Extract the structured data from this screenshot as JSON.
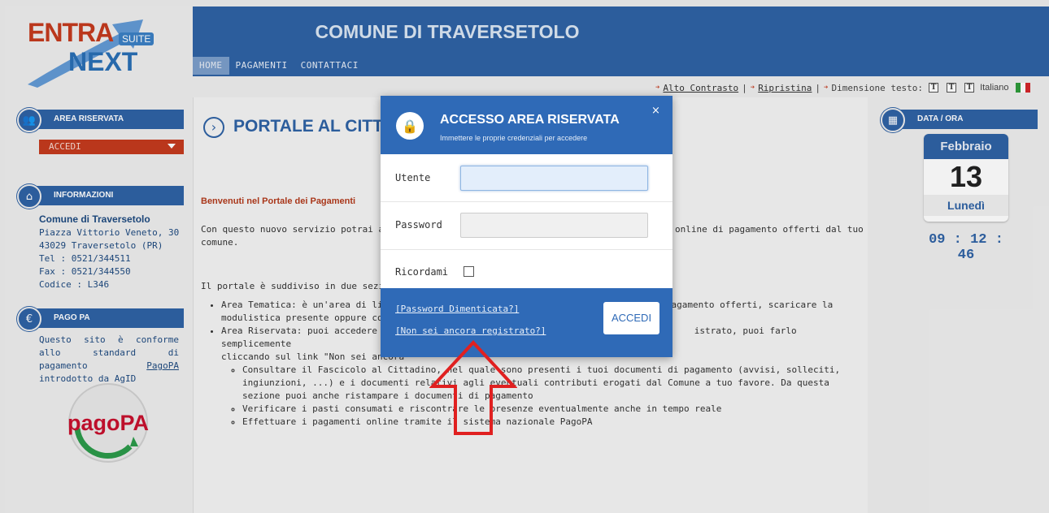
{
  "header": {
    "logo": {
      "entra": "ENTRA",
      "suite": "SUITE",
      "next": "NEXT"
    },
    "site_title": "COMUNE DI TRAVERSETOLO",
    "nav": [
      {
        "label": "HOME",
        "active": true
      },
      {
        "label": "PAGAMENTI",
        "active": false
      },
      {
        "label": "CONTATTACI",
        "active": false
      }
    ],
    "access": {
      "high_contrast": "Alto Contrasto",
      "sep1": "|",
      "restore": "Ripristina",
      "sep2": "|",
      "text_size_label": "Dimensione testo:",
      "size_glyph": "T",
      "language": "Italiano"
    }
  },
  "sidebar": {
    "area_riservata": {
      "title": "AREA RISERVATA",
      "dropdown": "ACCEDI"
    },
    "informazioni": {
      "title": "INFORMAZIONI",
      "name": "Comune di Traversetolo",
      "address": "Piazza Vittorio Veneto, 30",
      "city": "43029 Traversetolo (PR)",
      "tel": "Tel : 0521/344511",
      "fax": "Fax : 0521/344550",
      "code": "Codice : L346"
    },
    "pago_pa": {
      "title": "PAGO PA",
      "text_before": "Questo sito è conforme allo standard di pagamento ",
      "link": "PagoPA",
      "text_after": " introdotto da AgID",
      "logo_text": "pagoPA"
    }
  },
  "main": {
    "title": "PORTALE AL CITTAD",
    "welcome": "Benvenuti nel Portale dei Pagamenti",
    "intro_left": "Con questo nuovo servizio potrai accede",
    "intro_right": "online di pagamento offerti dal tuo",
    "intro_line2": "comune.",
    "sections_intro": "Il portale è suddiviso in due sezioni:",
    "bullet1_a": "Area Tematica: è un'area di libera",
    "bullet1_b": "ti di pagamento offerti, scaricare la",
    "bullet1_line2": "modulistica presente oppure cont",
    "bullet2_a": "Area Riservata: puoi accedere all'A",
    "bullet2_b": "istrato, puoi farlo semplicemente",
    "bullet2_line2": "cliccando sul link \"Non sei ancora",
    "sub1": "Consultare il Fascicolo al Cittadino, nel quale sono presenti i tuoi documenti di pagamento (avvisi, solleciti, ingiunzioni, ...) e i documenti relativi agli eventuali contributi erogati dal Comune a tuo favore. Da questa sezione puoi anche ristampare i documenti di pagamento",
    "sub2": "Verificare i pasti consumati e riscontrare le presenze eventualmente anche in tempo reale",
    "sub3": "Effettuare i pagamenti online tramite il sistema nazionale PagoPA"
  },
  "date_time": {
    "title": "DATA / ORA",
    "month": "Febbraio",
    "day": "13",
    "weekday": "Lunedì",
    "time": "09 : 12 : 46"
  },
  "login_modal": {
    "title": "ACCESSO AREA RISERVATA",
    "subtitle": "Immettere le proprie credenziali per accedere",
    "close": "×",
    "user_label": "Utente",
    "password_label": "Password",
    "remember_label": "Ricordami",
    "forgot_link": "[Password Dimenticata?]",
    "register_link": "[Non sei ancora registrato?]",
    "submit": "ACCEDI"
  },
  "icons": {
    "area_riservata": "users-icon",
    "informazioni": "home-icon",
    "pago_pa": "euro-icon",
    "data_ora": "calendar-icon",
    "modal": "user-lock-icon",
    "annotation": "red-arrow-up-icon"
  },
  "colors": {
    "primary": "#2f62a5",
    "accent": "#c43a1e",
    "modal": "#2f6ab7"
  }
}
